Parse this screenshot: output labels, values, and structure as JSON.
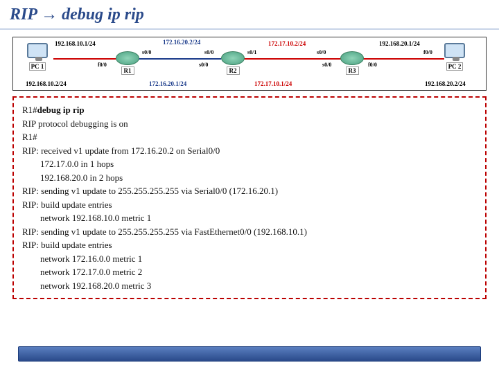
{
  "title": {
    "protocol": "RIP",
    "arrow": "→",
    "cmd": "debug ip rip"
  },
  "topology": {
    "pcs": [
      {
        "label": "PC 1"
      },
      {
        "label": "PC 2"
      }
    ],
    "routers": [
      {
        "label": "R1"
      },
      {
        "label": "R2"
      },
      {
        "label": "R3"
      }
    ],
    "ips": [
      {
        "text": "192.168.10.1/24",
        "color": "black"
      },
      {
        "text": "172.16.20.2/24",
        "color": "blue"
      },
      {
        "text": "172.17.10.2/24",
        "color": "red"
      },
      {
        "text": "192.168.20.1/24",
        "color": "black"
      },
      {
        "text": "192.168.10.2/24",
        "color": "black"
      },
      {
        "text": "172.16.20.1/24",
        "color": "blue"
      },
      {
        "text": "172.17.10.1/24",
        "color": "red"
      },
      {
        "text": "192.168.20.2/24",
        "color": "black"
      }
    ],
    "ifs": {
      "f00_r1": "f0/0",
      "s00": "s0/0",
      "s01": "s0/1",
      "f00_r3": "f0/0"
    }
  },
  "terminal": {
    "l1": "R1#debug ip rip",
    "l2": "RIP protocol debugging is on",
    "l3": "R1#",
    "l4": "RIP: received v1 update from 172.16.20.2 on Serial0/0",
    "l5": "172.17.0.0 in 1 hops",
    "l6": "192.168.20.0 in 2 hops",
    "l7": "RIP: sending v1 update to 255.255.255.255 via Serial0/0 (172.16.20.1)",
    "l8": "RIP: build update entries",
    "l9": "network 192.168.10.0 metric 1",
    "l10": "RIP: sending v1 update to 255.255.255.255 via FastEthernet0/0 (192.168.10.1)",
    "l11": "RIP: build update entries",
    "l12": "network 172.16.0.0 metric 1",
    "l13": "network 172.17.0.0 metric 2",
    "l14": "network 192.168.20.0 metric 3"
  }
}
